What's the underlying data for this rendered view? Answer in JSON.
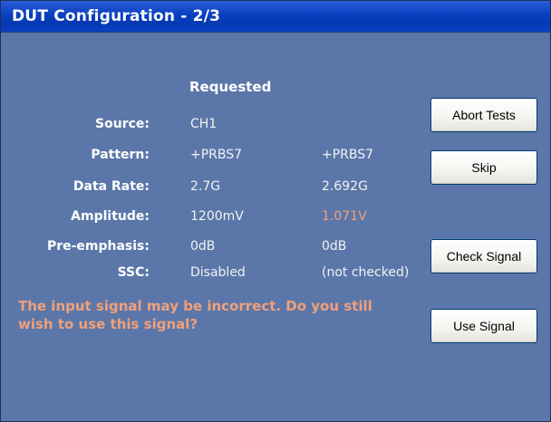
{
  "window": {
    "title": "DUT Configuration - 2/3"
  },
  "table": {
    "header": "Requested",
    "rows": [
      {
        "label": "Source:",
        "requested": "CH1",
        "measured": ""
      },
      {
        "label": "Pattern:",
        "requested": "+PRBS7",
        "measured": "+PRBS7"
      },
      {
        "label": "Data Rate:",
        "requested": "2.7G",
        "measured": "2.692G"
      },
      {
        "label": "Amplitude:",
        "requested": "1200mV",
        "measured": "1.071V"
      },
      {
        "label": "Pre-emphasis:",
        "requested": "0dB",
        "measured": "0dB"
      },
      {
        "label": "SSC:",
        "requested": "Disabled",
        "measured": "(not checked)"
      }
    ]
  },
  "warning": "The input signal may be incorrect.  Do you still wish to use this signal?",
  "buttons": {
    "abort": "Abort Tests",
    "skip": "Skip",
    "check": "Check Signal",
    "use": "Use Signal"
  },
  "colors": {
    "background": "#5b77a9",
    "titlebar": "#0a3fc0",
    "warning": "#f0a07a"
  }
}
